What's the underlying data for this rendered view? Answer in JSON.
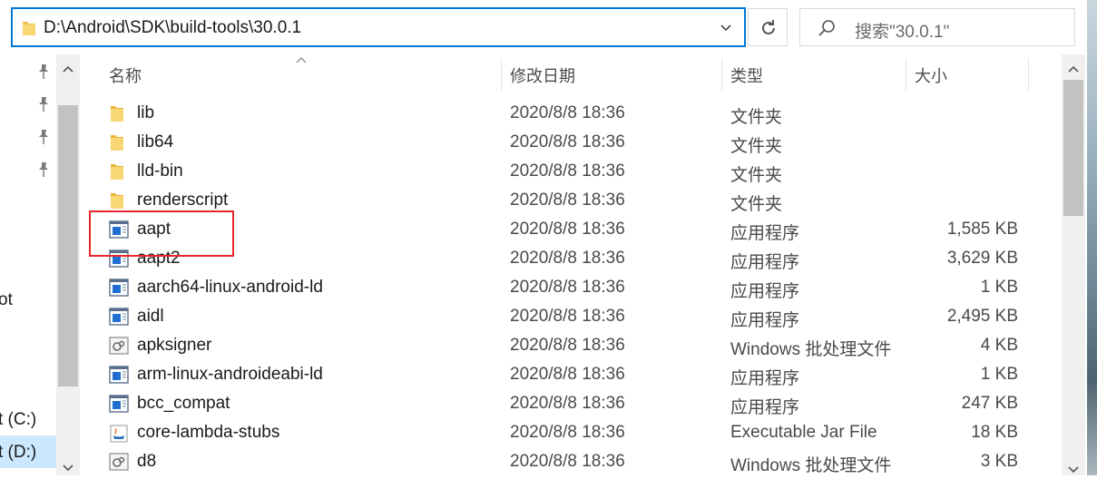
{
  "address_bar": {
    "path": "D:\\Android\\SDK\\build-tools\\30.0.1"
  },
  "search": {
    "placeholder": "搜索\"30.0.1\""
  },
  "nav": {
    "partial_items": [
      {
        "label": "ot"
      },
      {
        "label": "t (C:)"
      },
      {
        "label": "t (D:)"
      }
    ]
  },
  "columns": {
    "name": "名称",
    "date": "修改日期",
    "type": "类型",
    "size": "大小"
  },
  "files": [
    {
      "name": "lib",
      "date": "2020/8/8 18:36",
      "type": "文件夹",
      "size": "",
      "icon": "folder-icon"
    },
    {
      "name": "lib64",
      "date": "2020/8/8 18:36",
      "type": "文件夹",
      "size": "",
      "icon": "folder-icon"
    },
    {
      "name": "lld-bin",
      "date": "2020/8/8 18:36",
      "type": "文件夹",
      "size": "",
      "icon": "folder-icon"
    },
    {
      "name": "renderscript",
      "date": "2020/8/8 18:36",
      "type": "文件夹",
      "size": "",
      "icon": "folder-icon"
    },
    {
      "name": "aapt",
      "date": "2020/8/8 18:36",
      "type": "应用程序",
      "size": "1,585 KB",
      "icon": "exe-icon"
    },
    {
      "name": "aapt2",
      "date": "2020/8/8 18:36",
      "type": "应用程序",
      "size": "3,629 KB",
      "icon": "exe-icon"
    },
    {
      "name": "aarch64-linux-android-ld",
      "date": "2020/8/8 18:36",
      "type": "应用程序",
      "size": "1 KB",
      "icon": "exe-icon"
    },
    {
      "name": "aidl",
      "date": "2020/8/8 18:36",
      "type": "应用程序",
      "size": "2,495 KB",
      "icon": "exe-icon"
    },
    {
      "name": "apksigner",
      "date": "2020/8/8 18:36",
      "type": "Windows 批处理文件",
      "size": "4 KB",
      "icon": "batch-file-icon"
    },
    {
      "name": "arm-linux-androideabi-ld",
      "date": "2020/8/8 18:36",
      "type": "应用程序",
      "size": "1 KB",
      "icon": "exe-icon"
    },
    {
      "name": "bcc_compat",
      "date": "2020/8/8 18:36",
      "type": "应用程序",
      "size": "247 KB",
      "icon": "exe-icon"
    },
    {
      "name": "core-lambda-stubs",
      "date": "2020/8/8 18:36",
      "type": "Executable Jar File",
      "size": "18 KB",
      "icon": "jar-file-icon"
    },
    {
      "name": "d8",
      "date": "2020/8/8 18:36",
      "type": "Windows 批处理文件",
      "size": "3 KB",
      "icon": "batch-file-icon"
    }
  ],
  "colors": {
    "accent": "#0078d7",
    "selection": "#cce8ff",
    "annotation_box": "#e8262b",
    "folder": "#f5c451"
  }
}
